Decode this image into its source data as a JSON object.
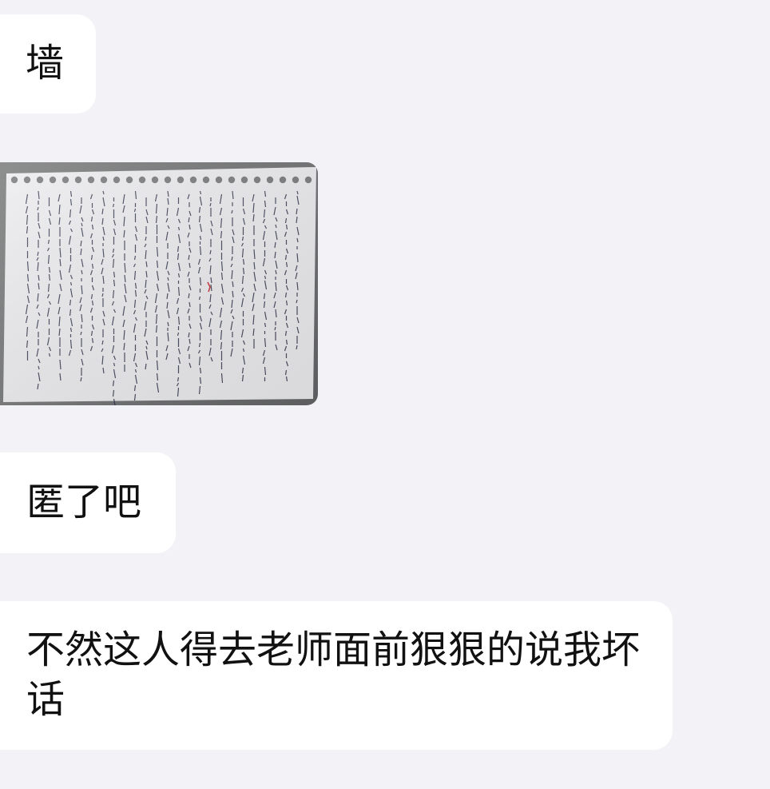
{
  "messages": [
    {
      "id": "msg1",
      "text": "墙"
    },
    {
      "id": "msg2",
      "text": "匿了吧"
    },
    {
      "id": "msg3",
      "text": "不然这人得去老师面前狠狠的说我坏话"
    }
  ],
  "photo": {
    "icon": "handwritten-notebook-page-photo",
    "colors": {
      "paper": "#ededf0",
      "ink": "#2a2e44",
      "background": "#7b7c7d"
    }
  }
}
